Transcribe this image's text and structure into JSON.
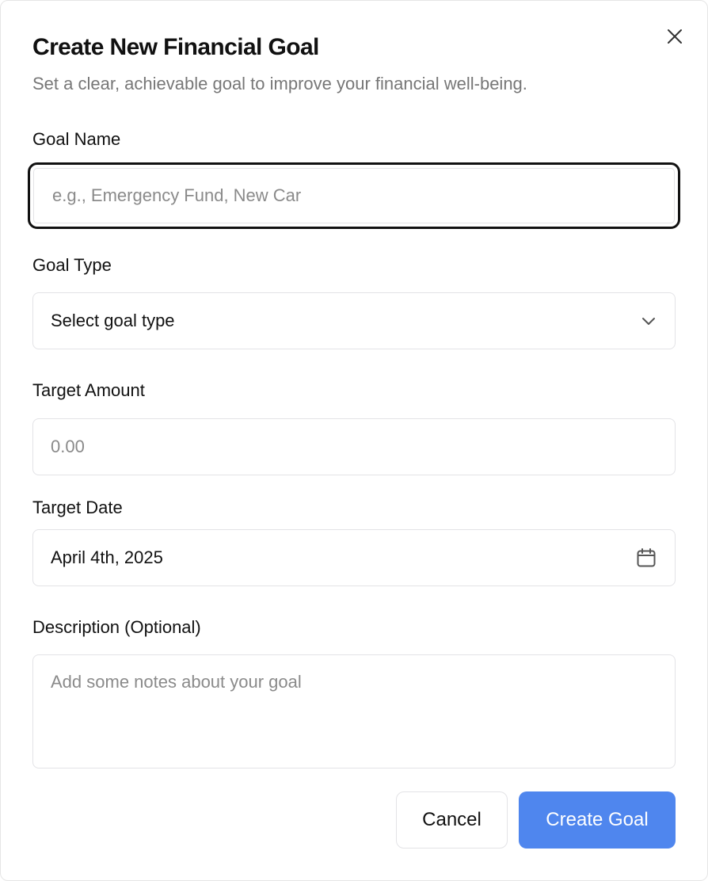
{
  "dialog": {
    "title": "Create New Financial Goal",
    "subtitle": "Set a clear, achievable goal to improve your financial well-being.",
    "close_icon": "close-icon"
  },
  "form": {
    "goal_name": {
      "label": "Goal Name",
      "value": "",
      "placeholder": "e.g., Emergency Fund, New Car"
    },
    "goal_type": {
      "label": "Goal Type",
      "selected": "Select goal type",
      "icon": "chevron-down-icon"
    },
    "target_amount": {
      "label": "Target Amount",
      "placeholder": "0.00"
    },
    "target_date": {
      "label": "Target Date",
      "value": "April 4th, 2025",
      "icon": "calendar-icon"
    },
    "description": {
      "label": "Description (Optional)",
      "placeholder": "Add some notes about your goal"
    }
  },
  "actions": {
    "cancel_label": "Cancel",
    "create_label": "Create Goal"
  },
  "colors": {
    "primary": "#4f86ee",
    "border": "#e3e3e6",
    "muted_text": "#777777",
    "focus_ring": "#111111"
  }
}
